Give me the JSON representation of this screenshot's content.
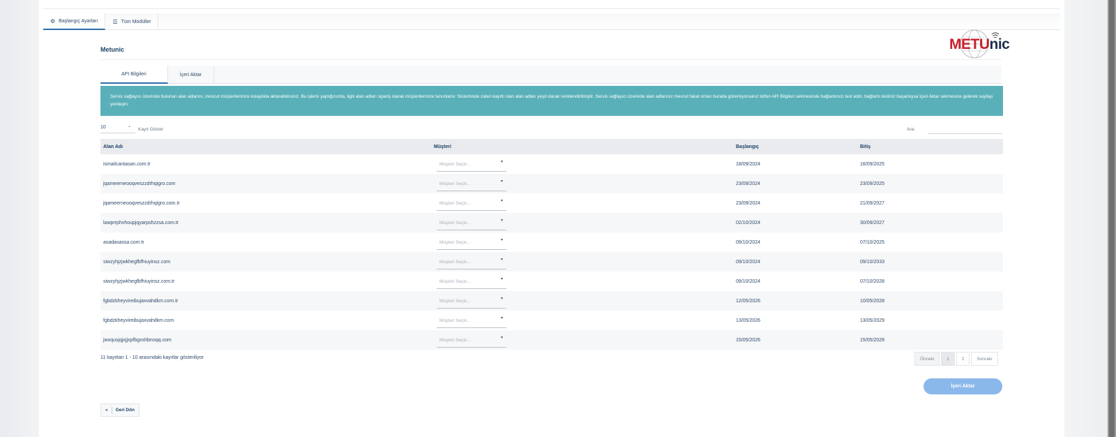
{
  "module_tabs": [
    {
      "label": "Başlangıç Ayarları",
      "icon": "cogs-icon"
    },
    {
      "label": "Tüm Modüller",
      "icon": "list-icon"
    }
  ],
  "page": {
    "title": "Metunic"
  },
  "logo": {
    "part1": "METU",
    "part2": "nic"
  },
  "inner_tabs": [
    {
      "label": "API Bilgileri"
    },
    {
      "label": "İçeri Aktar"
    }
  ],
  "info": {
    "text": "Servis sağlayıcı üzerinde bulunan alan adlarını, mevcut müşterilerinize kolaylıkla aktarabilirsiniz. Bu işlemi yaptığınızda, ilgili alan adları sipariş olarak müşterilerinize tanımlanır. Sisteminde zaten kayıtlı olan alan adları yeşil olarak renklendirilmiştir. Servis sağlayıcı üzerinde alan adlarınız mevcut fakat onları burada göremiyorsanız lütfen API Bilgileri sekmesinde bağlantınızı test edin, bağlantı testiniz başarılıysa İçeri Aktar sekmesine gelerek sayfayı yenileyin."
  },
  "controls": {
    "length_value": "10",
    "length_label": "Kayıt Göster",
    "search_label": "Ara:",
    "search_value": ""
  },
  "table": {
    "headers": [
      "Alan Adı",
      "Müşteri",
      "Başlangıç",
      "Bitiş"
    ],
    "select_placeholder": "Müşteri Seçin...",
    "rows": [
      {
        "domain": "ismailcantasan.com.tr",
        "start": "18/09/2024",
        "end": "16/09/2025"
      },
      {
        "domain": "jqameerneooqveszzdrhqigro.com",
        "start": "23/09/2024",
        "end": "23/09/2025"
      },
      {
        "domain": "jqameerneooqveszzdrhqigro.com.tr",
        "start": "23/09/2024",
        "end": "21/09/2027"
      },
      {
        "domain": "lawprrphvhoupjqyarpshzzsa.com.tr",
        "start": "02/10/2024",
        "end": "30/09/2027"
      },
      {
        "domain": "asadasassa.com.tr",
        "start": "09/10/2024",
        "end": "07/10/2025"
      },
      {
        "domain": "siwzyhjzjwkhegfbfhiuyinsz.com",
        "start": "09/10/2024",
        "end": "09/10/2033"
      },
      {
        "domain": "siwzyhjzjwkhegfbfhiuyinsz.com.tr",
        "start": "09/10/2024",
        "end": "07/10/2028"
      },
      {
        "domain": "fgbdzkheyvireibujaxvahdkm.com.tr",
        "start": "12/05/2026",
        "end": "10/05/2028"
      },
      {
        "domain": "fgbdzkheyvireibujaxvahdkm.com",
        "start": "13/05/2026",
        "end": "13/05/2029"
      },
      {
        "domain": "jwxqusjqjxjjxpfbgxshbnoqq.com",
        "start": "15/05/2026",
        "end": "15/05/2028"
      }
    ]
  },
  "footer": {
    "info": "11 kayıttan 1 - 10 arasındaki kayıtlar gösteriliyor",
    "prev": "Önceki",
    "pages": [
      "1",
      "2"
    ],
    "next": "Sonraki"
  },
  "buttons": {
    "import": "İçeri Aktar",
    "back": "Geri Dön"
  },
  "colors": {
    "info_bg": "#5ab0b9",
    "import_btn": "#8bb8ea",
    "logo_red": "#c8202a",
    "logo_dark": "#1c2f4a"
  }
}
